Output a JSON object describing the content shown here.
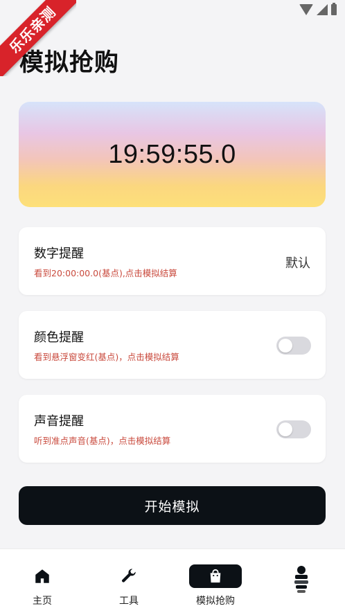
{
  "ribbon": {
    "text": "乐乐亲测"
  },
  "page": {
    "title": "模拟抢购"
  },
  "timer": {
    "value": "19:59:55.0"
  },
  "cards": [
    {
      "title": "数字提醒",
      "desc": "看到20:00:00.0(基点),点击模拟结算",
      "value": "默认"
    },
    {
      "title": "颜色提醒",
      "desc": "看到悬浮窗变红(基点)，点击模拟结算",
      "toggle": false
    },
    {
      "title": "声音提醒",
      "desc": "听到准点声音(基点)，点击模拟结算",
      "toggle": false
    }
  ],
  "start_button": {
    "label": "开始模拟"
  },
  "nav": {
    "items": [
      {
        "label": "主页",
        "icon": "home-icon"
      },
      {
        "label": "工具",
        "icon": "wrench-icon"
      },
      {
        "label": "模拟抢购",
        "icon": "shopping-bag-icon",
        "active": true
      },
      {
        "label": "",
        "icon": "avatar-icon"
      }
    ]
  },
  "colors": {
    "accent": "#0c1116",
    "desc_red": "#c94a3d",
    "ribbon": "#d8232a"
  }
}
